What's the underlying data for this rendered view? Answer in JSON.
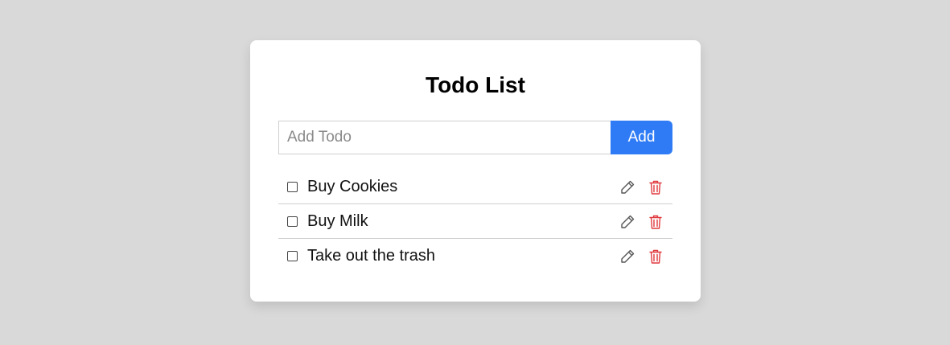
{
  "header": {
    "title": "Todo List"
  },
  "add_form": {
    "placeholder": "Add Todo",
    "button_label": "Add"
  },
  "colors": {
    "accent": "#2f7bf5",
    "delete": "#e0393e",
    "edit": "#555555"
  },
  "todos": [
    {
      "label": "Buy Cookies",
      "checked": false
    },
    {
      "label": "Buy Milk",
      "checked": false
    },
    {
      "label": "Take out the trash",
      "checked": false
    }
  ],
  "icons": {
    "edit": "pencil-icon",
    "delete": "trash-icon"
  }
}
